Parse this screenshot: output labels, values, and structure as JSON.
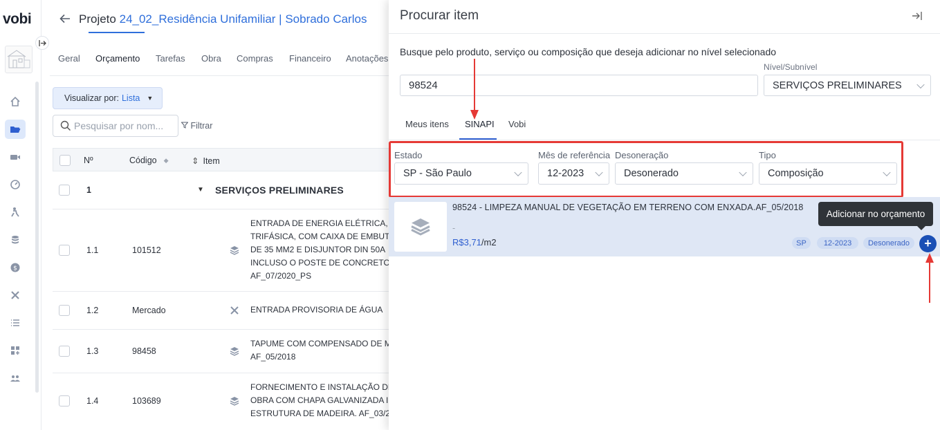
{
  "app": {
    "logo": "vobi"
  },
  "header": {
    "project_prefix": "Projeto",
    "project_name": "24_02_Residência Unifamiliar | Sobrado Carlos"
  },
  "tabs": [
    "Geral",
    "Orçamento",
    "Tarefas",
    "Obra",
    "Compras",
    "Financeiro",
    "Anotações"
  ],
  "toolbar": {
    "view_label": "Visualizar por:",
    "view_value": "Lista",
    "search_placeholder": "Pesquisar por nom...",
    "filter_label": "Filtrar"
  },
  "table": {
    "headers": {
      "num": "Nº",
      "code": "Código",
      "item": "Item"
    },
    "group": {
      "num": "1",
      "title": "SERVIÇOS PRELIMINARES"
    },
    "rows": [
      {
        "num": "1.1",
        "code": "101512",
        "lines": [
          "ENTRADA DE ENERGIA ELÉTRICA, A",
          "TRIFÁSICA, COM CAIXA DE EMBUT",
          "DE 35 MM2 E DISJUNTOR DIN 50A",
          "INCLUSO O POSTE DE CONCRETO.",
          "AF_07/2020_PS"
        ],
        "icon": "layers-icon"
      },
      {
        "num": "1.2",
        "code": "Mercado",
        "lines": [
          "ENTRADA PROVISORIA DE ÁGUA"
        ],
        "icon": "tools-icon"
      },
      {
        "num": "1.3",
        "code": "98458",
        "lines": [
          "TAPUME COM COMPENSADO DE M",
          "AF_05/2018"
        ],
        "icon": "layers-icon"
      },
      {
        "num": "1.4",
        "code": "103689",
        "lines": [
          "FORNECIMENTO E INSTALAÇÃO DE",
          "OBRA COM CHAPA GALVANIZADA I",
          "ESTRUTURA DE MADEIRA. AF_03/2"
        ],
        "icon": "layers-icon"
      }
    ]
  },
  "drawer": {
    "title": "Procurar item",
    "description": "Busque pelo produto, serviço ou composição que deseja adicionar no nível selecionado",
    "search_value": "98524",
    "nivel_label": "Nível/Subnível",
    "nivel_value": "SERVIÇOS PRELIMINARES",
    "tabs": [
      "Meus itens",
      "SINAPI",
      "Vobi"
    ],
    "active_tab": "SINAPI",
    "filters": {
      "estado": {
        "label": "Estado",
        "value": "SP - São Paulo"
      },
      "mes": {
        "label": "Mês de referência",
        "value": "12-2023"
      },
      "desoneracao": {
        "label": "Desoneração",
        "value": "Desonerado"
      },
      "tipo": {
        "label": "Tipo",
        "value": "Composição"
      }
    },
    "result": {
      "title": "98524 - LIMPEZA MANUAL DE VEGETAÇÃO EM TERRENO COM ENXADA.AF_05/2018",
      "dash": "-",
      "price": "R$3,71",
      "unit": "/m2",
      "chips": [
        "SP",
        "12-2023",
        "Desonerado"
      ],
      "add_symbol": "+"
    },
    "tooltip": "Adicionar no orçamento"
  },
  "colors": {
    "accent": "#2f6fdb",
    "annotation": "#e53935",
    "result_bg": "#dfe7f5"
  }
}
